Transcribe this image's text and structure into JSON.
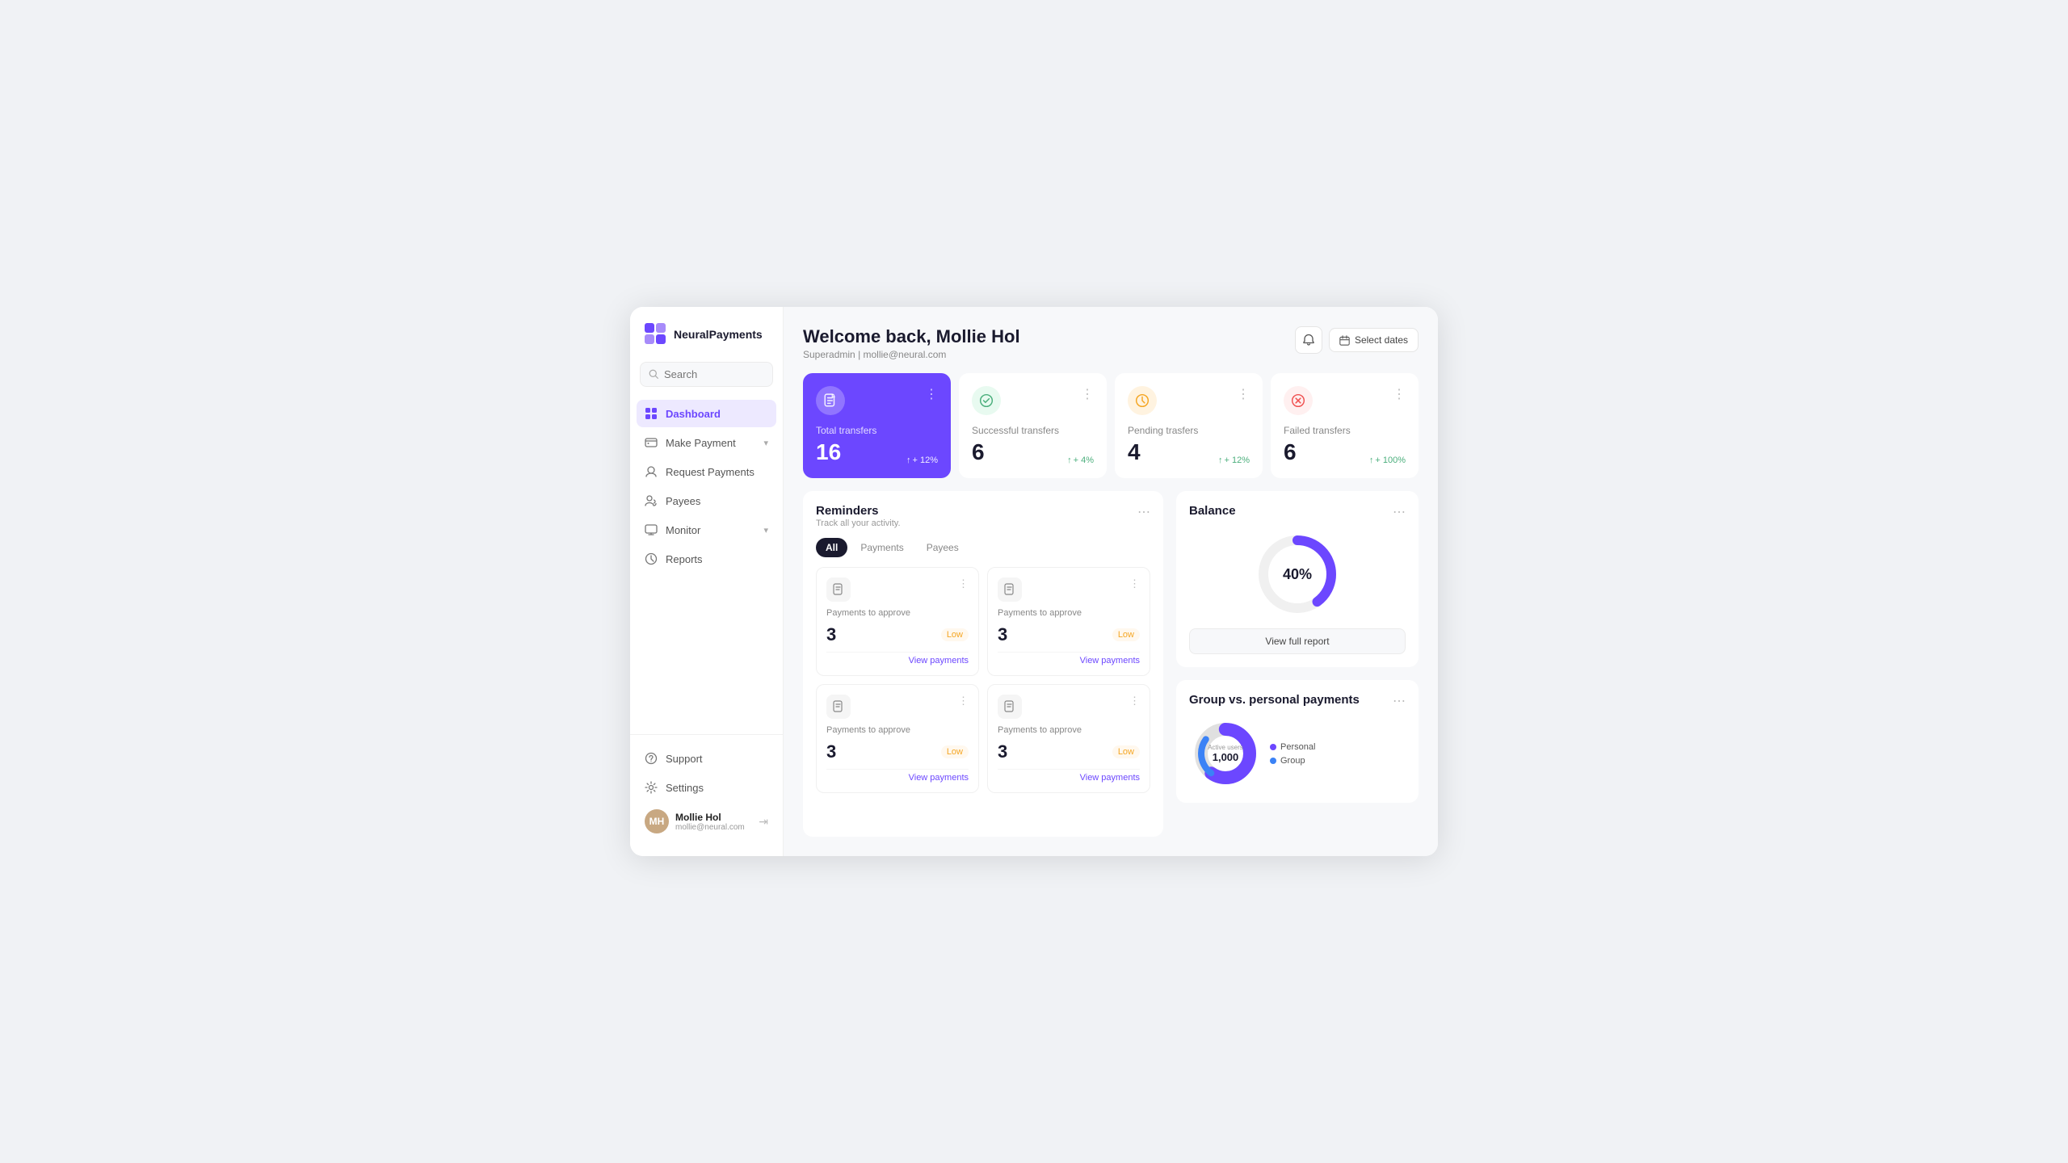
{
  "app": {
    "name": "NeuralPayments"
  },
  "sidebar": {
    "search_placeholder": "Search",
    "nav_items": [
      {
        "id": "dashboard",
        "label": "Dashboard",
        "active": true,
        "has_chevron": false
      },
      {
        "id": "make-payment",
        "label": "Make Payment",
        "active": false,
        "has_chevron": true
      },
      {
        "id": "request-payments",
        "label": "Request Payments",
        "active": false,
        "has_chevron": false
      },
      {
        "id": "payees",
        "label": "Payees",
        "active": false,
        "has_chevron": false
      },
      {
        "id": "monitor",
        "label": "Monitor",
        "active": false,
        "has_chevron": true
      },
      {
        "id": "reports",
        "label": "Reports",
        "active": false,
        "has_chevron": false
      }
    ],
    "bottom_items": [
      {
        "id": "support",
        "label": "Support"
      },
      {
        "id": "settings",
        "label": "Settings"
      }
    ],
    "user": {
      "name": "Mollie Hol",
      "email": "mollie@neural.com",
      "initials": "MH"
    }
  },
  "header": {
    "title": "Welcome back, Mollie Hol",
    "subtitle_role": "Superadmin",
    "subtitle_separator": "|",
    "subtitle_email": "mollie@neural.com",
    "date_btn": "Select dates"
  },
  "stats": [
    {
      "id": "total-transfers",
      "label": "Total transfers",
      "value": "16",
      "change": "+ 12%",
      "variant": "purple"
    },
    {
      "id": "successful-transfers",
      "label": "Successful transfers",
      "value": "6",
      "change": "+ 4%",
      "variant": "green"
    },
    {
      "id": "pending-transfers",
      "label": "Pending trasfers",
      "value": "4",
      "change": "+ 12%",
      "variant": "orange"
    },
    {
      "id": "failed-transfers",
      "label": "Failed transfers",
      "value": "6",
      "change": "+ 100%",
      "variant": "red"
    }
  ],
  "reminders": {
    "title": "Reminders",
    "subtitle": "Track all your activity.",
    "tabs": [
      "All",
      "Payments",
      "Payees"
    ],
    "active_tab": "All",
    "cards": [
      {
        "label": "Payments to approve",
        "count": "3",
        "priority": "Low",
        "link": "View payments"
      },
      {
        "label": "Payments to approve",
        "count": "3",
        "priority": "Low",
        "link": "View payments"
      },
      {
        "label": "Payments to approve",
        "count": "3",
        "priority": "Low",
        "link": "View payments"
      },
      {
        "label": "Payments to approve",
        "count": "3",
        "priority": "Low",
        "link": "View payments"
      }
    ]
  },
  "balance": {
    "title": "Balance",
    "percent": "40%",
    "percent_number": 40,
    "view_full_report": "View full report"
  },
  "group_payments": {
    "title": "Group vs. personal payments",
    "legend": [
      {
        "label": "Personal",
        "color": "#6c47ff"
      },
      {
        "label": "Group",
        "color": "#3b82f6"
      }
    ],
    "active_users_label": "Active users",
    "active_users_value": "1,000"
  }
}
